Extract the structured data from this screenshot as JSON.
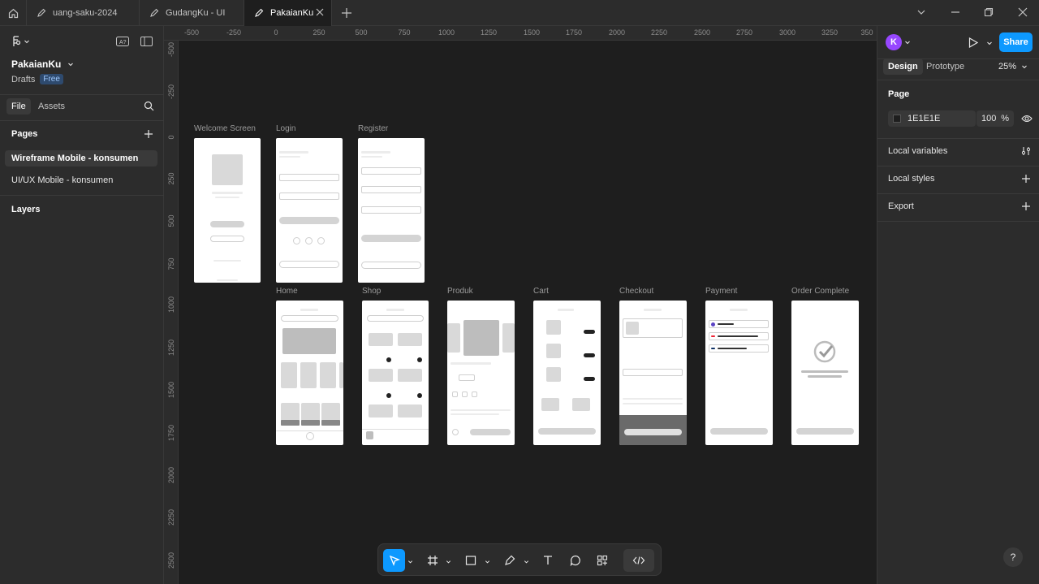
{
  "tabs": [
    {
      "label": "uang-saku-2024",
      "icon": "draft-icon"
    },
    {
      "label": "GudangKu - UI",
      "icon": "draft-icon"
    },
    {
      "label": "PakaianKu",
      "icon": "draft-icon",
      "active": true
    }
  ],
  "file": {
    "name": "PakaianKu",
    "location": "Drafts",
    "plan_badge": "Free"
  },
  "left_tabs": {
    "file": "File",
    "assets": "Assets"
  },
  "pages": {
    "heading": "Pages",
    "items": [
      {
        "label": "Wireframe Mobile - konsumen",
        "selected": true
      },
      {
        "label": "UI/UX Mobile - konsumen",
        "selected": false
      }
    ]
  },
  "layers": {
    "heading": "Layers"
  },
  "ruler_top": [
    "-500",
    "-250",
    "0",
    "250",
    "500",
    "750",
    "1000",
    "1250",
    "1500",
    "1750",
    "2000",
    "2250",
    "2500",
    "2750",
    "3000",
    "3250",
    "350"
  ],
  "ruler_left": [
    "-500",
    "-250",
    "0",
    "250",
    "500",
    "750",
    "1000",
    "1250",
    "1500",
    "1750",
    "2000",
    "2250",
    "2500"
  ],
  "frames": {
    "welcome": "Welcome Screen",
    "login": "Login",
    "register": "Register",
    "home": "Home",
    "shop": "Shop",
    "produk": "Produk",
    "cart": "Cart",
    "checkout": "Checkout",
    "payment": "Payment",
    "order_complete": "Order Complete"
  },
  "right": {
    "avatar_initial": "K",
    "share": "Share",
    "tabs": {
      "design": "Design",
      "prototype": "Prototype"
    },
    "zoom": "25%",
    "page_section": "Page",
    "bg_color": "1E1E1E",
    "opacity": "100",
    "opacity_unit": "%",
    "local_variables": "Local variables",
    "local_styles": "Local styles",
    "export": "Export"
  },
  "help": "?",
  "colors": {
    "accent": "#0d99ff",
    "avatar": "#9747ff",
    "canvas": "#1e1e1e",
    "panel": "#2c2c2c"
  }
}
